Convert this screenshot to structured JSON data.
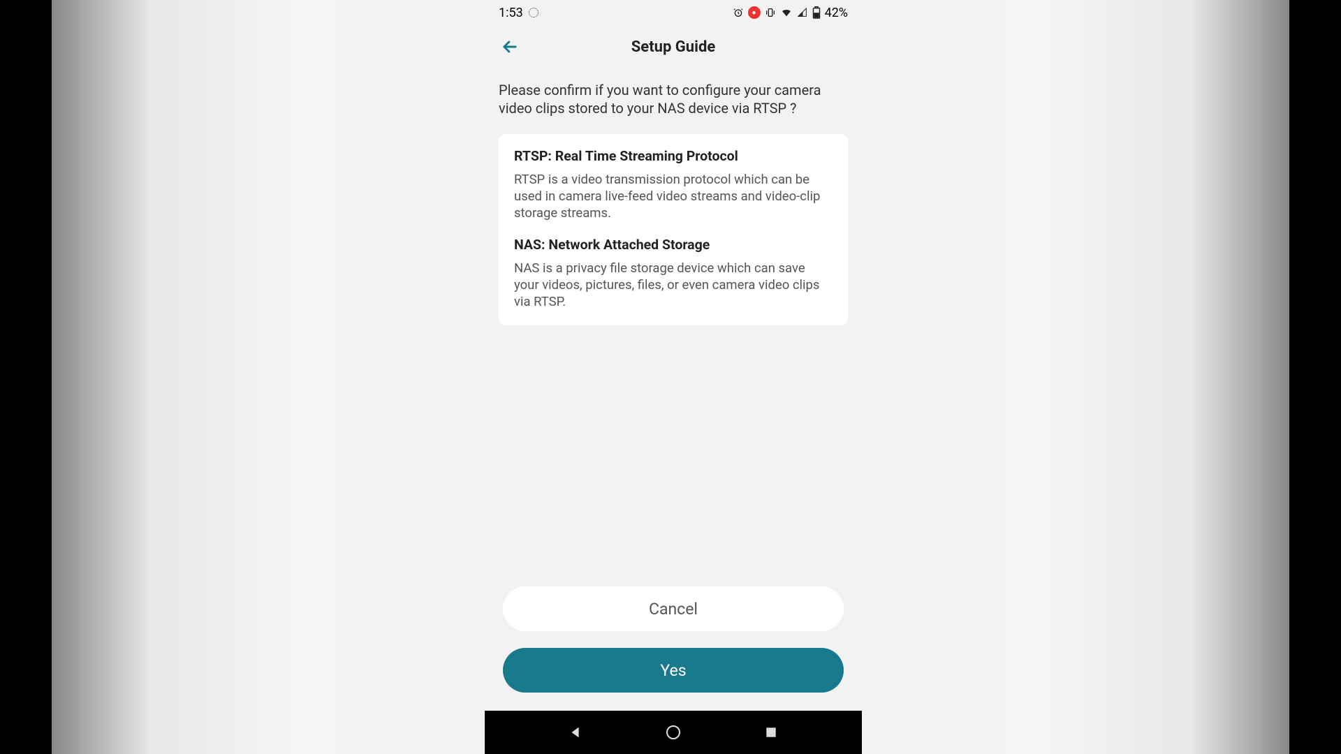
{
  "status": {
    "time": "1:53",
    "battery": "42%"
  },
  "appbar": {
    "title": "Setup Guide"
  },
  "prompt": "Please confirm if you want to configure your camera video clips stored to your NAS device via RTSP ?",
  "card": {
    "rtsp_title": "RTSP: Real Time Streaming Protocol",
    "rtsp_body": "RTSP is a video transmission protocol which can be used in camera live-feed video streams and video-clip storage streams.",
    "nas_title": "NAS: Network Attached Storage",
    "nas_body": "NAS is a privacy file storage device which can save your videos, pictures, files, or even camera video clips via RTSP."
  },
  "buttons": {
    "cancel": "Cancel",
    "yes": "Yes"
  }
}
